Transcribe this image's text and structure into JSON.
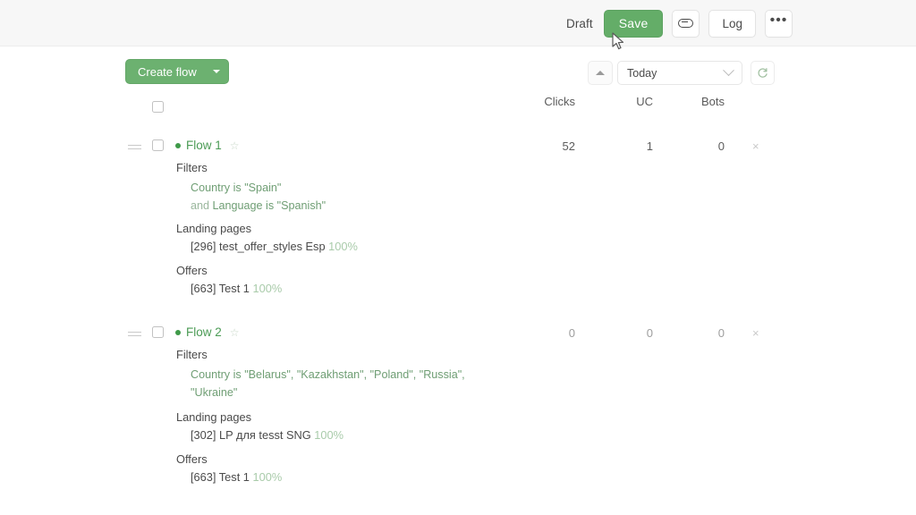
{
  "topbar": {
    "draft_label": "Draft",
    "save_label": "Save",
    "link_icon": "chain-link-icon",
    "log_label": "Log",
    "more_label": "•••"
  },
  "toolbar": {
    "create_flow_label": "Create flow",
    "collapse_icon": "caret-up-icon",
    "period_value": "Today",
    "refresh_icon": "refresh-icon"
  },
  "table": {
    "columns": [
      "Clicks",
      "UC",
      "Bots"
    ],
    "rows": [
      {
        "name": "Flow 1",
        "status": "active",
        "clicks": "52",
        "uc": "1",
        "bots": "0",
        "sections": {
          "filters_label": "Filters",
          "filters": [
            {
              "conj": "",
              "text": "Country is \"Spain\""
            },
            {
              "conj": "and ",
              "text": "Language is \"Spanish\""
            }
          ],
          "landing_label": "Landing pages",
          "landing_name": "[296] test_offer_styles Esp",
          "landing_pct": "100%",
          "offers_label": "Offers",
          "offer_name": "[663] Test 1",
          "offer_pct": "100%"
        }
      },
      {
        "name": "Flow 2",
        "status": "active",
        "clicks": "0",
        "uc": "0",
        "bots": "0",
        "sections": {
          "filters_label": "Filters",
          "filters": [
            {
              "conj": "",
              "text": "Country is \"Belarus\", \"Kazakhstan\", \"Poland\", \"Russia\", \"Ukraine\""
            }
          ],
          "landing_label": "Landing pages",
          "landing_name": "[302] LP для tesst SNG",
          "landing_pct": "100%",
          "offers_label": "Offers",
          "offer_name": "[663] Test 1",
          "offer_pct": "100%"
        }
      }
    ],
    "delete_icon": "×"
  },
  "colors": {
    "brand_green": "#64ad68",
    "create_green": "#6cb170",
    "flow_link": "#4b9b55",
    "filter_text": "#6f9e74",
    "pct_text": "#a9cbaa",
    "topbar_bg": "#f7f7f7"
  }
}
